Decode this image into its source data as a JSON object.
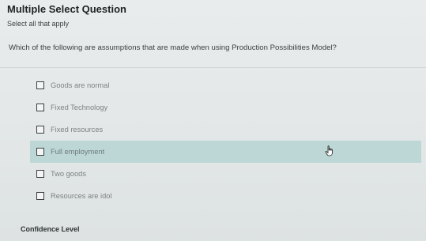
{
  "question": {
    "type_label": "Multiple Select Question",
    "instruction": "Select all that apply",
    "prompt": "Which of the following are assumptions that are made when using Production Possibilities Model?"
  },
  "options": [
    {
      "label": "Goods are normal",
      "checked": false
    },
    {
      "label": "Fixed Technology",
      "checked": false
    },
    {
      "label": "Fixed resources",
      "checked": false
    },
    {
      "label": "Full employment",
      "checked": false,
      "hovered": true
    },
    {
      "label": "Two goods",
      "checked": false
    },
    {
      "label": "Resources are idol",
      "checked": false
    }
  ],
  "footer": {
    "confidence_label": "Confidence Level"
  },
  "colors": {
    "hover_highlight": "#bdd7d7",
    "background": "#e6eaea"
  },
  "icons": {
    "cursor": "hand-pointer-icon"
  }
}
